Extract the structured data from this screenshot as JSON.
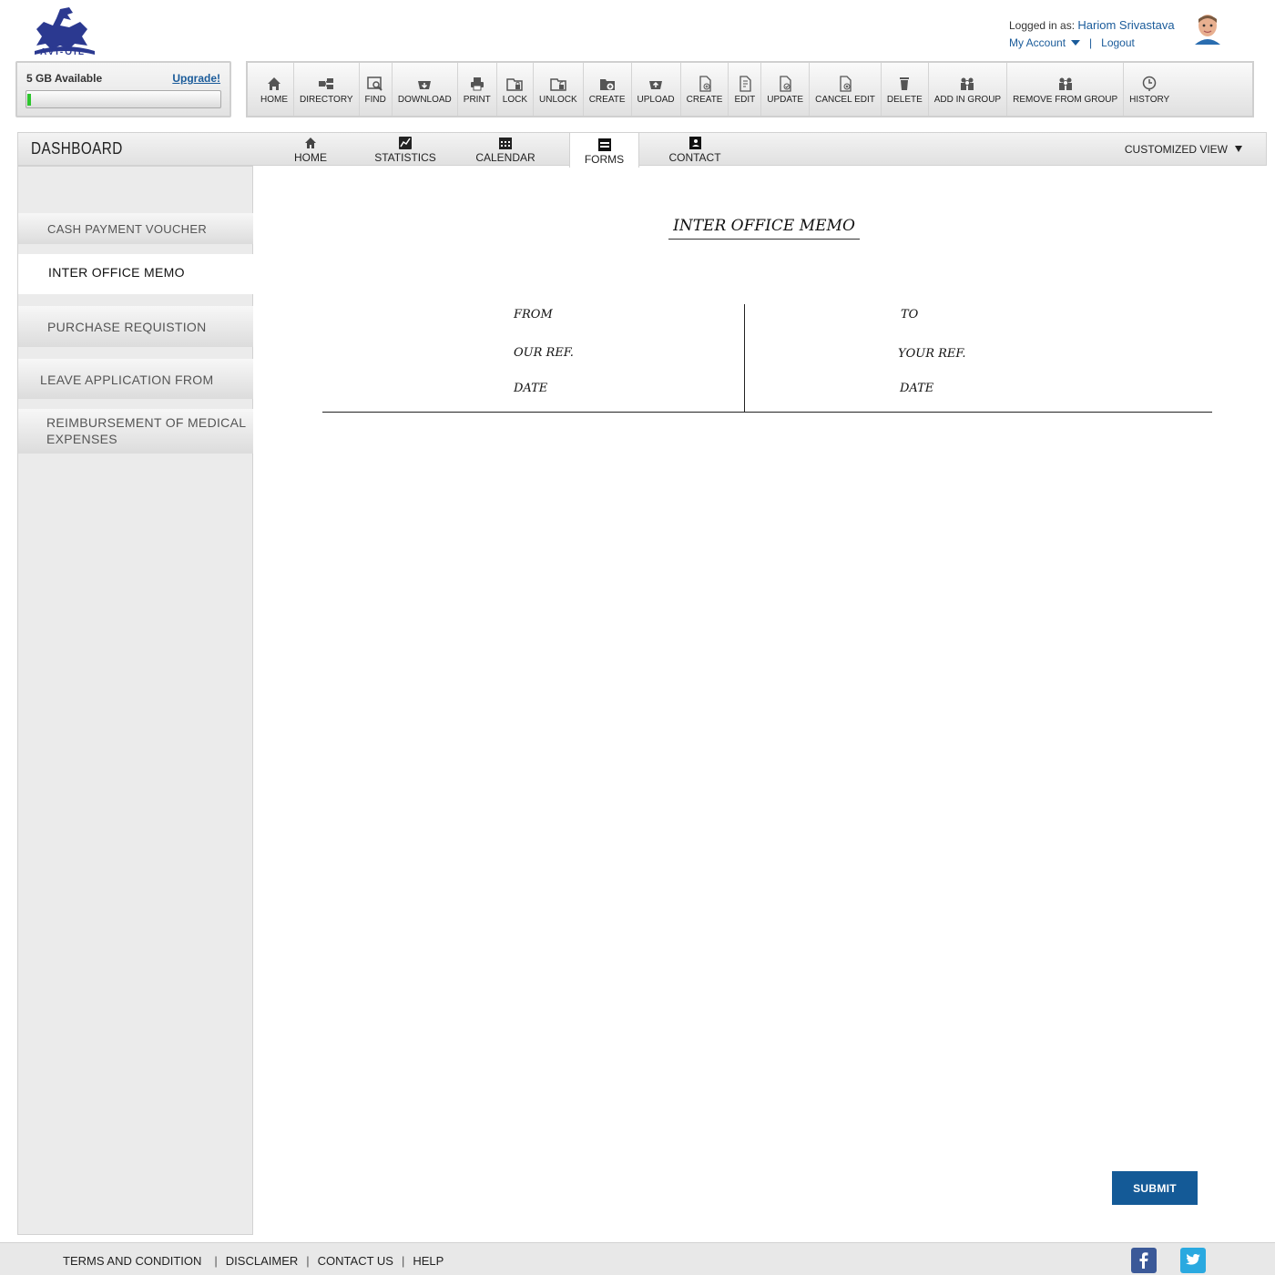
{
  "brand": {
    "logo_text": "AVI-OIL"
  },
  "user": {
    "logged_in_label": "Logged in as:",
    "name": "Hariom Srivastava",
    "my_account": "My Account",
    "separator": "|",
    "logout": "Logout"
  },
  "storage": {
    "available": "5 GB Available",
    "upgrade": "Upgrade!",
    "used_fraction": 0.02
  },
  "toolbar": {
    "items": [
      {
        "label": "HOME",
        "icon": "home-icon"
      },
      {
        "label": "DIRECTORY",
        "icon": "directory-icon"
      },
      {
        "label": "FIND",
        "icon": "find-icon"
      },
      {
        "label": "DOWNLOAD",
        "icon": "download-icon"
      },
      {
        "label": "PRINT",
        "icon": "print-icon"
      },
      {
        "label": "LOCK",
        "icon": "lock-icon"
      },
      {
        "label": "UNLOCK",
        "icon": "unlock-icon"
      },
      {
        "label": "CREATE",
        "icon": "create-folder-icon"
      },
      {
        "label": "UPLOAD",
        "icon": "upload-icon"
      },
      {
        "label": "CREATE",
        "icon": "create-file-icon"
      },
      {
        "label": "EDIT",
        "icon": "edit-icon"
      },
      {
        "label": "UPDATE",
        "icon": "update-icon"
      },
      {
        "label": "CANCEL EDIT",
        "icon": "cancel-edit-icon"
      },
      {
        "label": "DELETE",
        "icon": "delete-icon"
      },
      {
        "label": "ADD IN GROUP",
        "icon": "add-group-icon"
      },
      {
        "label": "REMOVE FROM GROUP",
        "icon": "remove-group-icon"
      },
      {
        "label": "HISTORY",
        "icon": "history-icon"
      }
    ]
  },
  "dashboard": {
    "title": "DASHBOARD",
    "tabs": [
      {
        "label": "HOME",
        "icon": "home-icon"
      },
      {
        "label": "STATISTICS",
        "icon": "statistics-icon"
      },
      {
        "label": "CALENDAR",
        "icon": "calendar-icon"
      },
      {
        "label": "FORMS",
        "icon": "forms-icon",
        "active": true
      },
      {
        "label": "CONTACT",
        "icon": "contact-icon"
      }
    ],
    "customized_view": "CUSTOMIZED VIEW"
  },
  "sidebar": {
    "items": [
      {
        "label": "CASH PAYMENT VOUCHER"
      },
      {
        "label": "INTER OFFICE MEMO",
        "active": true
      },
      {
        "label": "PURCHASE REQUISTION"
      },
      {
        "label": "LEAVE APPLICATION FROM"
      },
      {
        "label": "REIMBURSEMENT OF MEDICAL EXPENSES"
      }
    ]
  },
  "memo": {
    "title": "INTER OFFICE MEMO",
    "left": {
      "from": "FROM",
      "our_ref": "OUR REF.",
      "date": "DATE"
    },
    "right": {
      "to": "TO",
      "your_ref": "YOUR REF.",
      "date": "DATE"
    },
    "submit": "SUBMIT"
  },
  "footer": {
    "links": [
      "TERMS AND CONDITION",
      "DISCLAIMER",
      "CONTACT US",
      "HELP"
    ],
    "separator": "|",
    "social": [
      "facebook-icon",
      "twitter-icon"
    ]
  },
  "colors": {
    "brand_blue": "#2b3990",
    "link_blue": "#1a5b9a",
    "submit_bg": "#145a97",
    "progress_green": "#2dc52d",
    "facebook": "#3b5998",
    "twitter": "#2aa9e0"
  }
}
